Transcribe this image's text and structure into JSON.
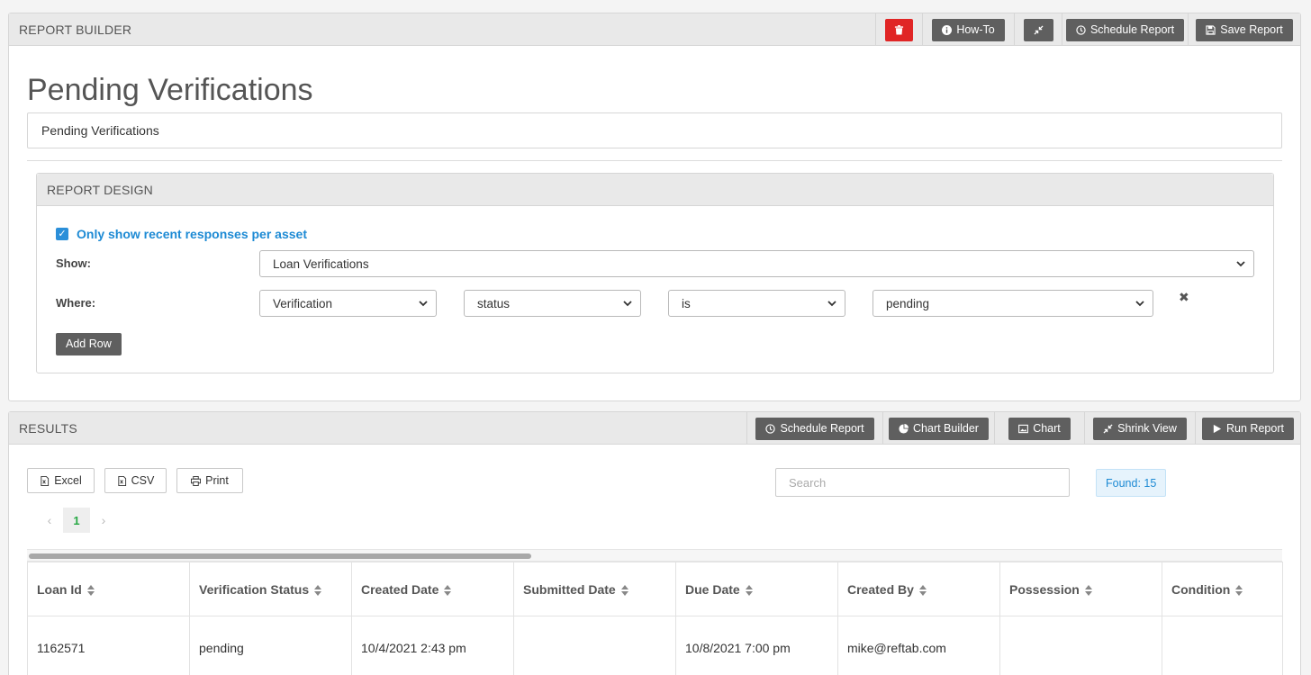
{
  "builder": {
    "header": "REPORT BUILDER",
    "buttons": {
      "howto": "How-To",
      "schedule": "Schedule Report",
      "save": "Save Report"
    },
    "report_title": "Pending Verifications",
    "title_value": "Pending Verifications"
  },
  "design": {
    "header": "REPORT DESIGN",
    "recent_label": "Only show recent responses per asset",
    "show_label": "Show:",
    "show_value": "Loan Verifications",
    "where_label": "Where:",
    "where": [
      "Verification",
      "status",
      "is",
      "pending"
    ],
    "add_row": "Add Row"
  },
  "results": {
    "header": "RESULTS",
    "buttons": {
      "schedule": "Schedule Report",
      "chart_builder": "Chart Builder",
      "chart": "Chart",
      "shrink": "Shrink View",
      "run": "Run Report"
    },
    "export": {
      "excel": "Excel",
      "csv": "CSV",
      "print": "Print"
    },
    "search_placeholder": "Search",
    "found": "Found: 15",
    "page": "1",
    "columns": [
      "Loan Id",
      "Verification Status",
      "Created Date",
      "Submitted Date",
      "Due Date",
      "Created By",
      "Possession",
      "Condition"
    ],
    "rows": [
      [
        "1162571",
        "pending",
        "10/4/2021 2:43 pm",
        "",
        "10/8/2021 7:00 pm",
        "mike@reftab.com",
        "",
        ""
      ]
    ]
  },
  "colors": {
    "accent": "#1d8ad4",
    "danger": "#e02525",
    "button": "#5f5f5f",
    "page_active": "#27a844"
  }
}
